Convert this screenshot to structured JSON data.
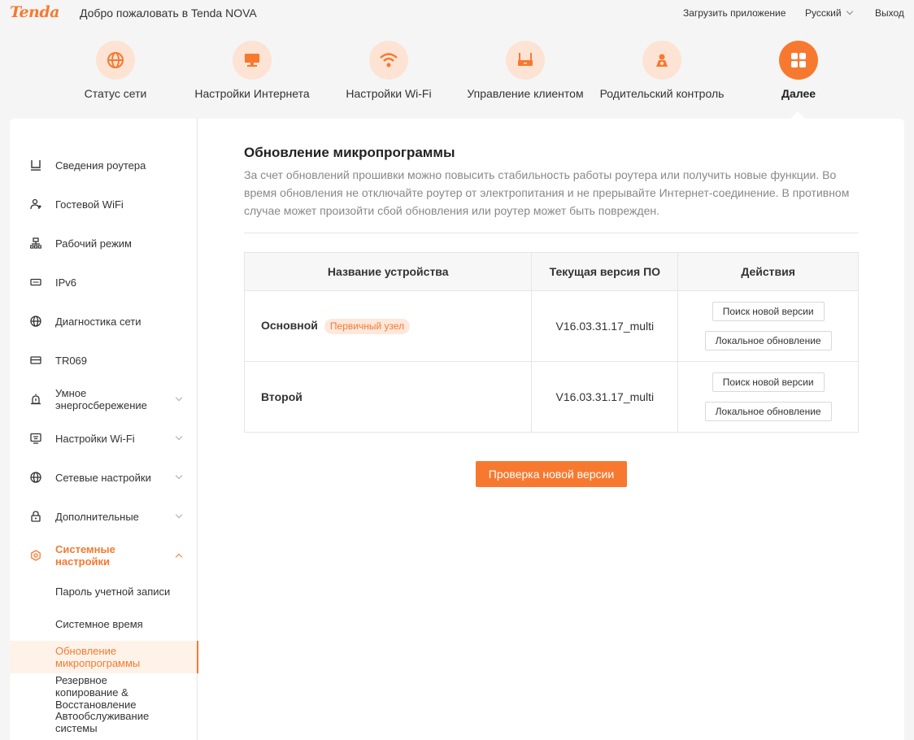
{
  "header": {
    "logo": "Tenda",
    "welcome": "Добро пожаловать в Tenda NOVA",
    "download_app": "Загрузить приложение",
    "language": "Русский",
    "logout": "Выход"
  },
  "nav": [
    {
      "label": "Статус сети",
      "icon": "globe-icon"
    },
    {
      "label": "Настройки Интернета",
      "icon": "monitor-icon"
    },
    {
      "label": "Настройки Wi-Fi",
      "icon": "wifi-icon"
    },
    {
      "label": "Управление клиентом",
      "icon": "router-icon"
    },
    {
      "label": "Родительский контроль",
      "icon": "parent-icon"
    },
    {
      "label": "Далее",
      "icon": "grid-icon",
      "active": true
    }
  ],
  "sidebar": {
    "items": [
      {
        "label": "Сведения роутера",
        "icon": "router-info-icon"
      },
      {
        "label": "Гостевой WiFi",
        "icon": "guest-icon"
      },
      {
        "label": "Рабочий режим",
        "icon": "mode-icon"
      },
      {
        "label": "IPv6",
        "icon": "ipv6-icon"
      },
      {
        "label": "Диагностика сети",
        "icon": "globe-icon"
      },
      {
        "label": "TR069",
        "icon": "tr069-icon"
      },
      {
        "label": "Умное энергосбережение",
        "icon": "alarm-icon"
      },
      {
        "label": "Настройки Wi-Fi",
        "icon": "wifi-settings-icon"
      },
      {
        "label": "Сетевые настройки",
        "icon": "globe-icon"
      },
      {
        "label": "Дополнительные",
        "icon": "lock-icon"
      },
      {
        "label": "Системные настройки",
        "icon": "gear-icon"
      }
    ],
    "sub_items": [
      {
        "label": "Пароль учетной записи"
      },
      {
        "label": "Системное время"
      },
      {
        "label": "Обновление микропрограммы"
      },
      {
        "label": "Резервное копирование & Восстановление"
      },
      {
        "label": "Автообслуживание системы"
      }
    ]
  },
  "main": {
    "title": "Обновление микропрограммы",
    "description": "За счет обновлений прошивки можно повысить стабильность работы роутера или получить новые функции. Во время обновления не отключайте роутер от электропитания и не прерывайте Интернет-соединение. В противном случае может произойти сбой обновления или роутер может быть поврежден.",
    "table": {
      "headers": [
        "Название устройства",
        "Текущая версия ПО",
        "Действия"
      ],
      "rows": [
        {
          "name": "Основной",
          "badge": "Первичный узел",
          "version": "V16.03.31.17_multi",
          "btn_search": "Поиск новой версии",
          "btn_local": "Локальное обновление"
        },
        {
          "name": "Второй",
          "version": "V16.03.31.17_multi",
          "btn_search": "Поиск новой версии",
          "btn_local": "Локальное обновление"
        }
      ]
    },
    "check_button": "Проверка новой версии"
  },
  "colors": {
    "accent": "#f77930",
    "accent_light": "#fde3d4"
  }
}
